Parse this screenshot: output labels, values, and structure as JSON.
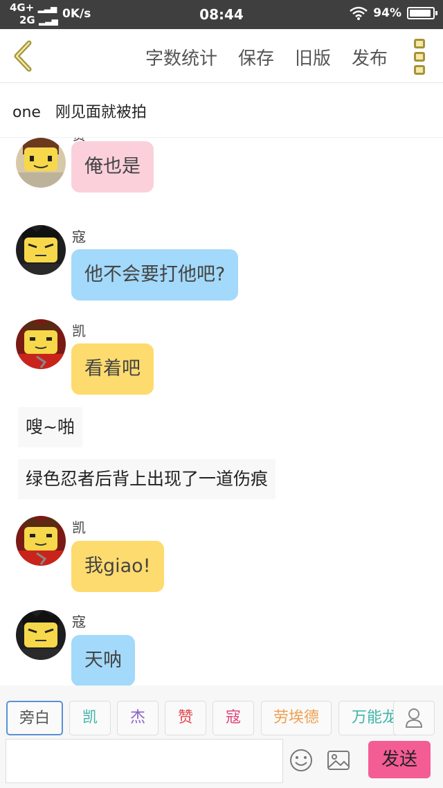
{
  "status": {
    "net1": "4G+",
    "net2": "2G",
    "speed": "0K/s",
    "time": "08:44",
    "battery": "94%",
    "battery_level": 0.94
  },
  "toolbar": {
    "actions": [
      "字数统计",
      "保存",
      "旧版",
      "发布"
    ]
  },
  "story": {
    "title": "one   刚见面就被拍"
  },
  "colors": {
    "pink": "#fbd0db",
    "blue": "#a3d9fa",
    "yellow": "#fddb6e",
    "send": "#f45c94"
  },
  "messages": [
    {
      "type": "char",
      "sender": "赞",
      "text": "俺也是",
      "color": "pink"
    },
    {
      "type": "char",
      "sender": "寇",
      "text": "他不会要打他吧?",
      "color": "blue"
    },
    {
      "type": "char",
      "sender": "凯",
      "text": "看着吧",
      "color": "yellow"
    },
    {
      "type": "narration",
      "text": "嗖~啪"
    },
    {
      "type": "narration",
      "text": "绿色忍者后背上出现了一道伤痕"
    },
    {
      "type": "char",
      "sender": "凯",
      "text": "我giao!",
      "color": "yellow"
    },
    {
      "type": "char",
      "sender": "寇",
      "text": "天呐",
      "color": "blue"
    }
  ],
  "roles": [
    {
      "name": "旁白",
      "color": "#555555"
    },
    {
      "name": "凯",
      "color": "#3fb5a8"
    },
    {
      "name": "杰",
      "color": "#8b5fc7"
    },
    {
      "name": "赞",
      "color": "#e0454b"
    },
    {
      "name": "寇",
      "color": "#e0457b"
    },
    {
      "name": "劳埃德",
      "color": "#f0a050"
    },
    {
      "name": "万能龙",
      "color": "#3fb5a8"
    }
  ],
  "input": {
    "value": "",
    "send_label": "发送"
  }
}
